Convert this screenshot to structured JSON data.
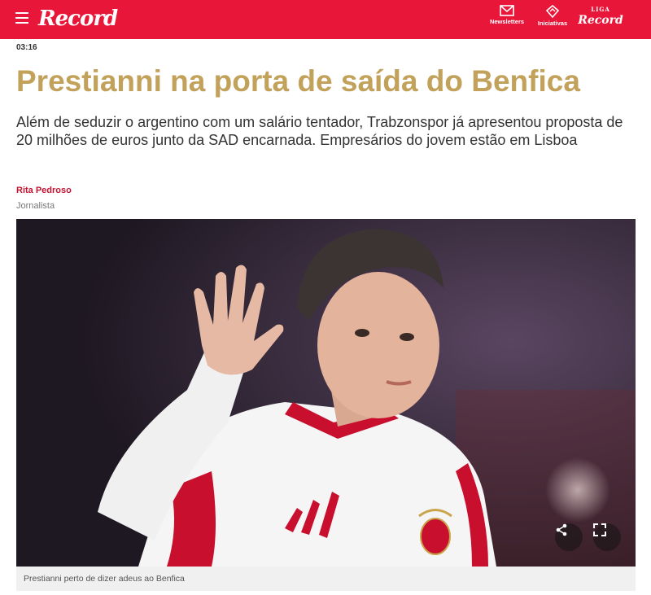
{
  "header": {
    "logo_text": "Record",
    "newsletters_label": "Newsletters",
    "iniciativas_label": "Iniciativas",
    "record_badge_top": "LIGA",
    "record_badge_word": "Record"
  },
  "article": {
    "time": "03:16",
    "headline": "Prestianni na porta de saída do Benfica",
    "lead": "Além de seduzir o argentino com um salário tentador, Trabzonspor já apresentou proposta de 20 milhões de euros junto da SAD encarnada. Empresários do jovem estão em Lisboa",
    "author_name": "Rita Pedroso",
    "author_role": "Jornalista"
  },
  "photo": {
    "caption": "Prestianni perto de dizer adeus ao Benfica",
    "share_icon": "share-icon",
    "fullscreen_icon": "fullscreen-icon"
  },
  "colors": {
    "brand_red": "#e8173a",
    "headline_gold": "#c2a15b",
    "author_red": "#c4122f"
  }
}
